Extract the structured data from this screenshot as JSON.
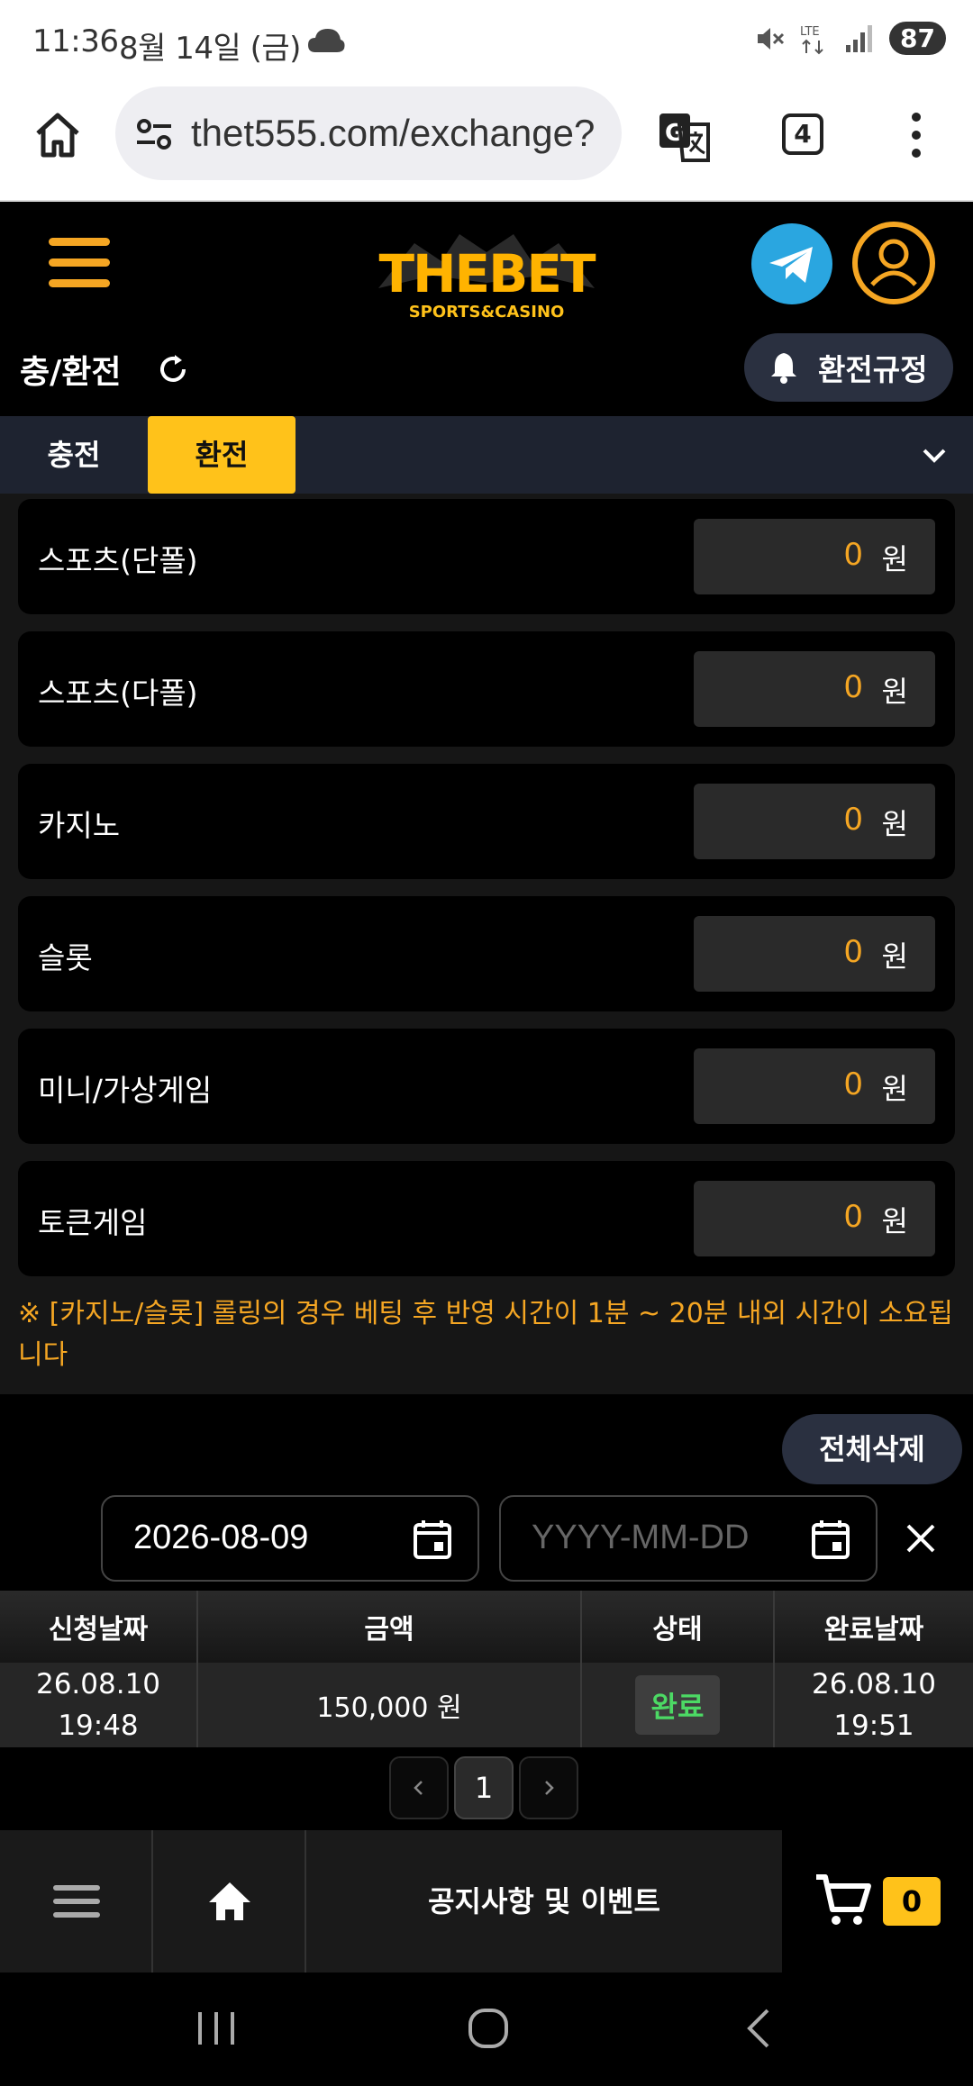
{
  "status_bar": {
    "time": "11:36",
    "date": "8월 14일 (금)",
    "battery": "87"
  },
  "browser": {
    "url": "thet555.com/exchange?",
    "tab_count": "4"
  },
  "header": {
    "page_title": "충/환전",
    "rules_button": "환전규정"
  },
  "tabs": [
    {
      "label": "충전",
      "active": false
    },
    {
      "label": "환전",
      "active": true
    }
  ],
  "balances": [
    {
      "label": "스포츠(단폴)",
      "value": "0",
      "unit": "원"
    },
    {
      "label": "스포츠(다폴)",
      "value": "0",
      "unit": "원"
    },
    {
      "label": "카지노",
      "value": "0",
      "unit": "원"
    },
    {
      "label": "슬롯",
      "value": "0",
      "unit": "원"
    },
    {
      "label": "미니/가상게임",
      "value": "0",
      "unit": "원"
    },
    {
      "label": "토큰게임",
      "value": "0",
      "unit": "원"
    }
  ],
  "notice": "※ [카지노/슬롯] 롤링의 경우 베팅 후 반영 시간이 1분 ~ 20분 내외 시간이 소요됩니다",
  "history": {
    "delete_all": "전체삭제",
    "date_from": "2026-08-09",
    "date_to_placeholder": "YYYY-MM-DD",
    "columns": [
      "신청날짜",
      "금액",
      "상태",
      "완료날짜"
    ],
    "rows": [
      {
        "request_date": "26.08.10",
        "request_time": "19:48",
        "amount": "150,000 원",
        "status": "완료",
        "done_date": "26.08.10",
        "done_time": "19:51"
      }
    ],
    "page": "1"
  },
  "bottom_nav": {
    "notice_label": "공지사항 및 이벤트",
    "cart_count": "0"
  },
  "colors": {
    "accent": "#ffc21a",
    "orange": "#f5a623",
    "status_done": "#4cd964",
    "telegram": "#2aa6e0"
  }
}
